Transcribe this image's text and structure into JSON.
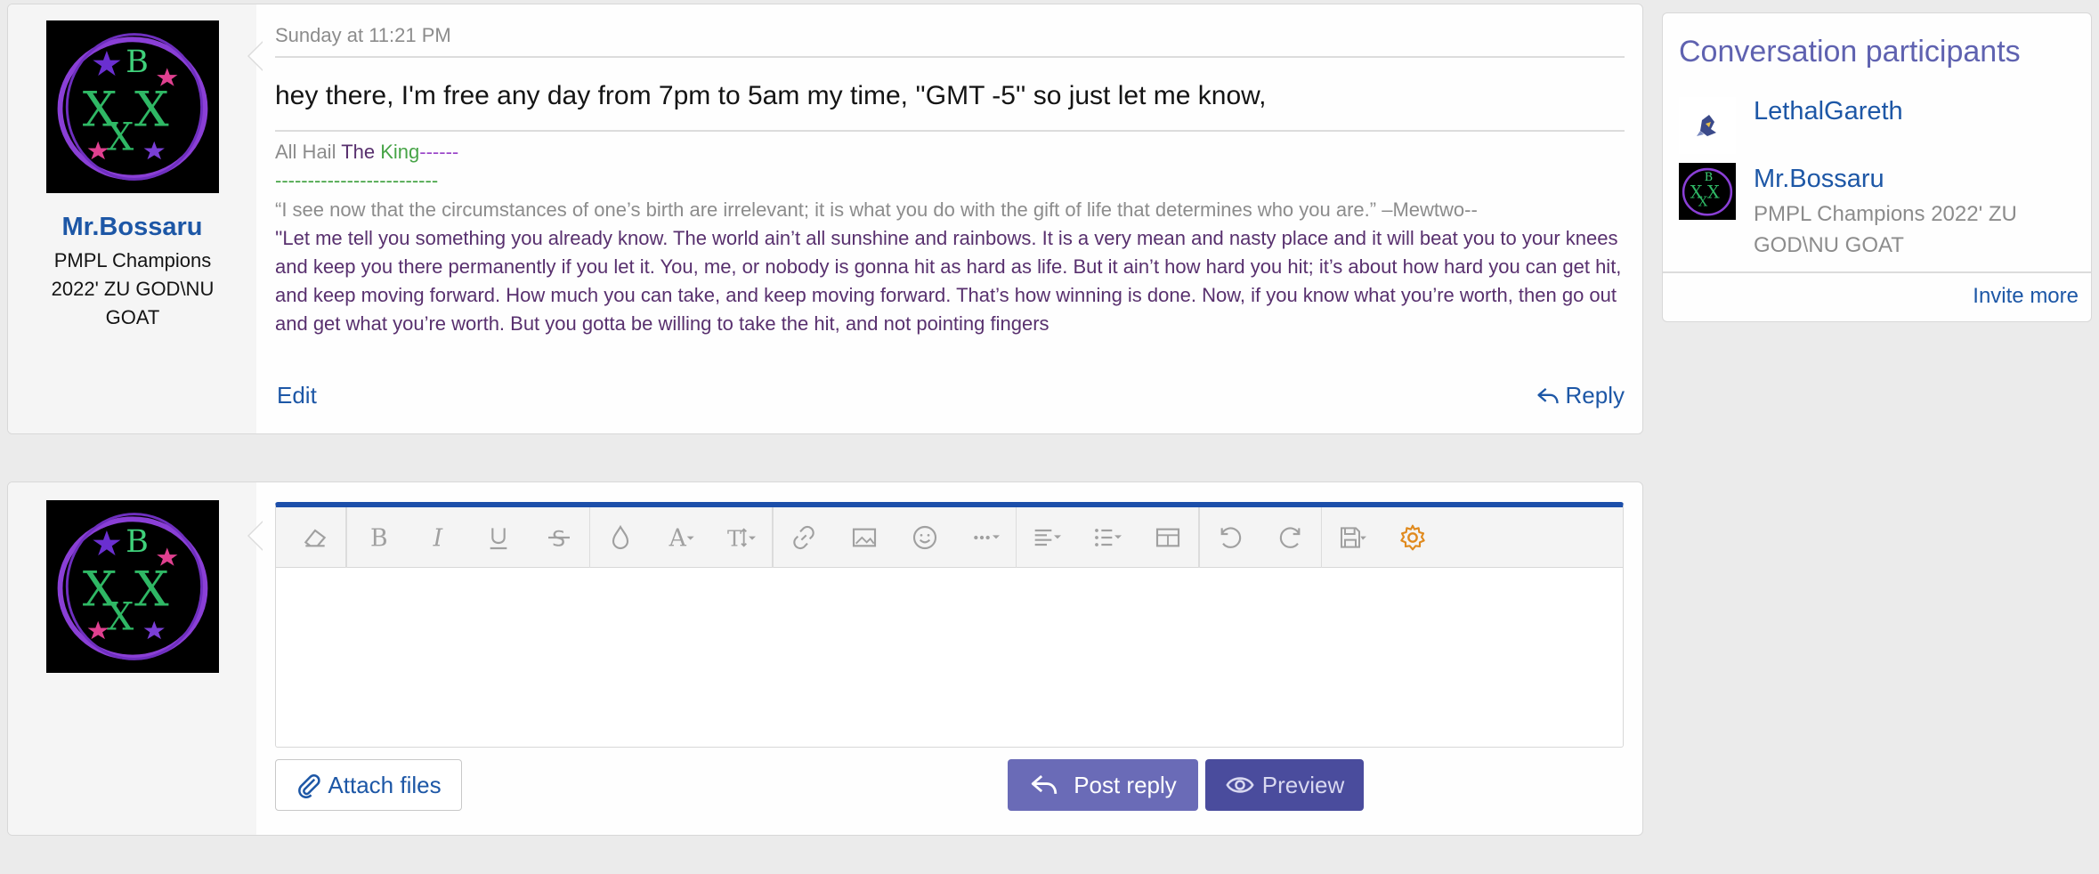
{
  "message": {
    "username": "Mr.Bossaru",
    "user_title": "PMPL Champions 2022' ZU GOD\\NU GOAT",
    "date": "Sunday at 11:21 PM",
    "body": "hey there, I'm free any day from 7pm to 5am my time, ''GMT -5'' so just let me know,",
    "signature": {
      "line1_a": "All Hail ",
      "line1_b": "The ",
      "line1_c": "King",
      "line1_d": "------",
      "line2": "-------------------------",
      "quote1": "“I see now that the circumstances of one’s birth are irrelevant; it is what you do with the gift of life that determines who you are.” –Mewtwo--",
      "quote2": "''Let me tell you something you already know. The world ain’t all sunshine and rainbows. It is a very mean and nasty place and it will beat you to your knees and keep you there permanently if you let it. You, me, or nobody is gonna hit as hard as life. But it ain’t how hard you hit; it’s about how hard you can get hit, and keep moving forward. How much you can take, and keep moving forward. That’s how winning is done. Now, if you know what you’re worth, then go out and get what you’re worth. But you gotta be willing to take the hit, and not pointing fingers"
    },
    "edit_label": "Edit",
    "reply_label": "Reply"
  },
  "reply_box": {
    "toolbar_icons": [
      "eraser-icon",
      "bold-icon",
      "italic-icon",
      "underline-icon",
      "strikethrough-icon",
      "text-color-icon",
      "font-family-icon",
      "font-size-icon",
      "link-icon",
      "image-icon",
      "smiley-icon",
      "more-icon",
      "align-icon",
      "list-icon",
      "table-icon",
      "undo-icon",
      "redo-icon",
      "drafts-icon",
      "settings-icon"
    ],
    "attach_label": "Attach files",
    "post_label": "Post reply",
    "preview_label": "Preview",
    "accent_color": "#1d4faa"
  },
  "sidebar": {
    "title": "Conversation participants",
    "participants": [
      {
        "name": "LethalGareth",
        "title": ""
      },
      {
        "name": "Mr.Bossaru",
        "title": "PMPL Champions 2022' ZU GOD\\NU GOAT"
      }
    ],
    "invite_label": "Invite more"
  },
  "colors": {
    "link": "#1d57a6",
    "post_button": "#6a6bb7",
    "preview_button": "#4a4c9d",
    "sidebar_title": "#5f62b0",
    "settings_icon": "#e08a1e"
  }
}
